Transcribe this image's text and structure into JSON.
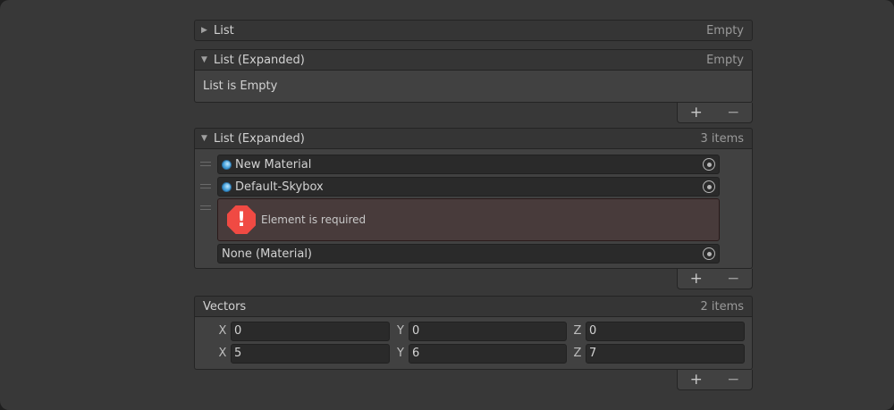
{
  "lists": [
    {
      "title": "List",
      "count": "Empty"
    },
    {
      "title": "List (Expanded)",
      "count": "Empty",
      "empty_text": "List is Empty"
    },
    {
      "title": "List (Expanded)",
      "count": "3 items",
      "items": [
        "New Material",
        "Default-Skybox"
      ],
      "error": "Element is required",
      "none_item": "None (Material)"
    }
  ],
  "vectors": {
    "title": "Vectors",
    "count": "2 items",
    "labels": [
      "X",
      "Y",
      "Z"
    ],
    "rows": [
      [
        "0",
        "0",
        "0"
      ],
      [
        "5",
        "6",
        "7"
      ]
    ]
  },
  "footer": {
    "add": "+",
    "remove": "−"
  },
  "icons": {
    "error": "!"
  }
}
